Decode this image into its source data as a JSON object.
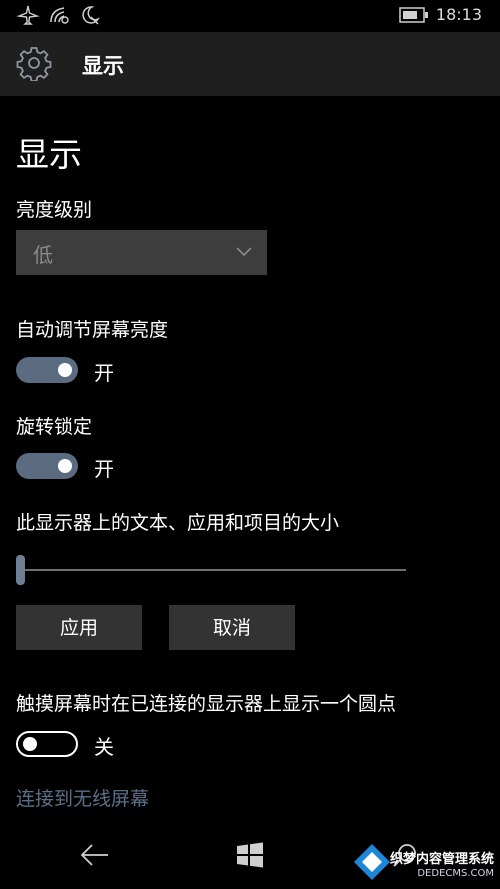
{
  "status_bar": {
    "time": "18:13",
    "icons": [
      "airplane-icon",
      "wifi-icon",
      "quiet-hours-icon",
      "battery-icon"
    ]
  },
  "header": {
    "title": "显示",
    "icon": "gear-icon"
  },
  "page": {
    "title": "显示"
  },
  "brightness": {
    "label": "亮度级别",
    "selected": "低"
  },
  "auto_brightness": {
    "label": "自动调节屏幕亮度",
    "state": "开",
    "on": true
  },
  "rotation_lock": {
    "label": "旋转锁定",
    "state": "开",
    "on": true
  },
  "scaling": {
    "label": "此显示器上的文本、应用和项目的大小",
    "slider_value": 0
  },
  "buttons": {
    "apply": "应用",
    "cancel": "取消"
  },
  "touch_dot": {
    "label": "触摸屏幕时在已连接的显示器上显示一个圆点",
    "state": "关",
    "on": false
  },
  "wireless": {
    "link": "连接到无线屏幕"
  },
  "nav": {
    "icons": [
      "back-icon",
      "windows-start-icon",
      "search-icon"
    ]
  },
  "watermark": {
    "brand": "织梦内容管理系统",
    "domain": "DEDECMS.COM"
  },
  "colors": {
    "background": "#000000",
    "header_bg": "#1f1f1f",
    "accent": "#5b6b80",
    "link": "#5b6f88"
  }
}
